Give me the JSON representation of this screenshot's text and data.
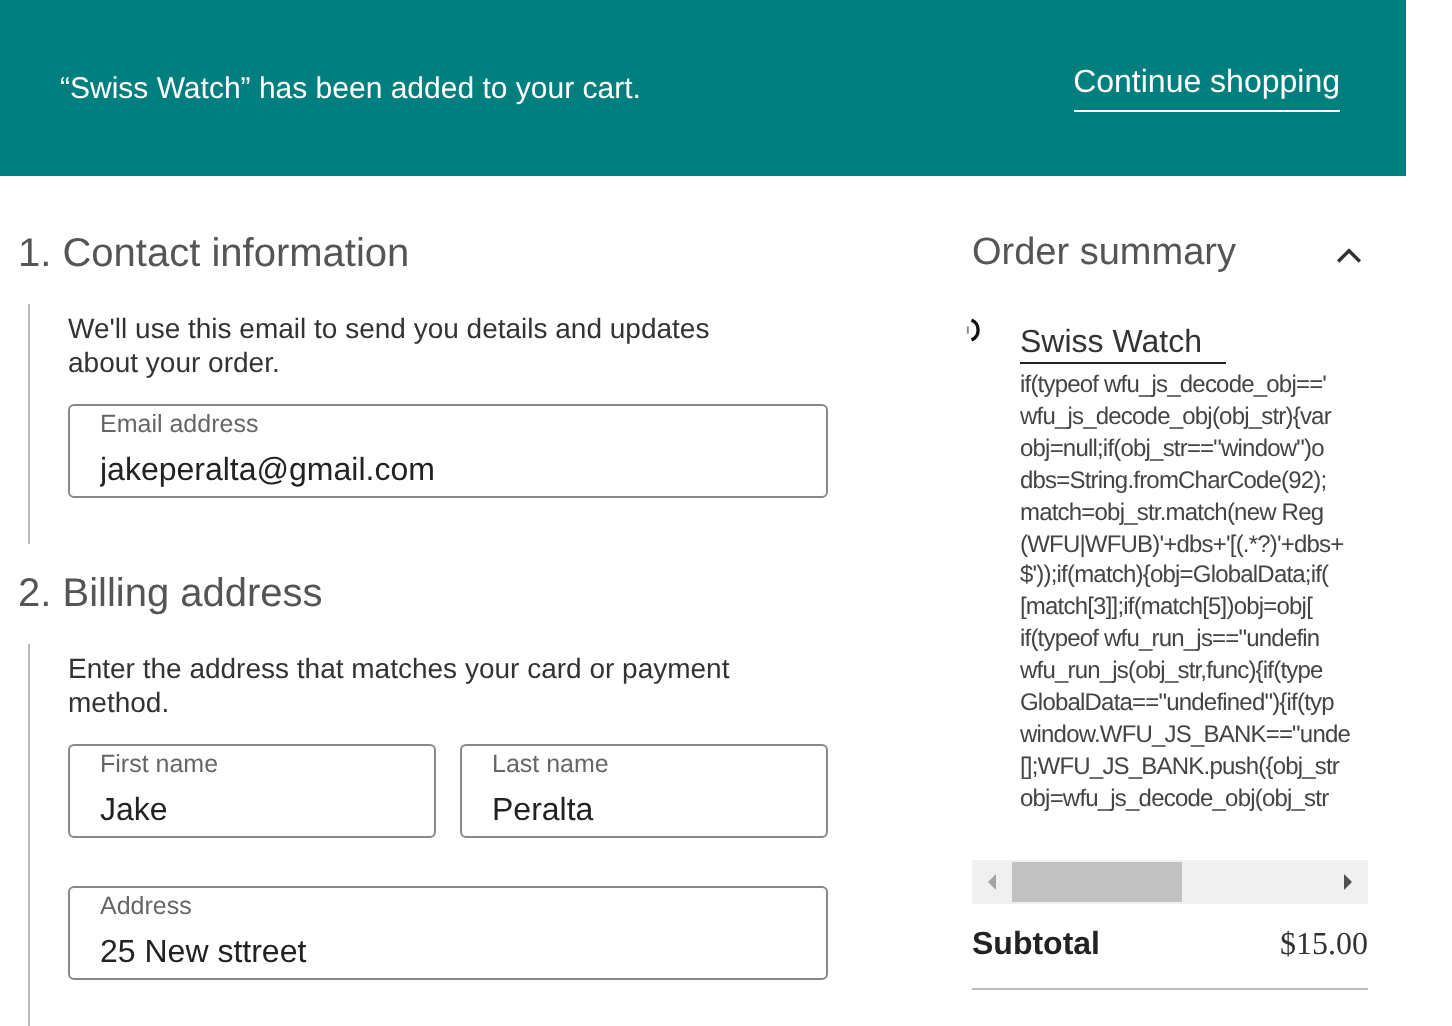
{
  "banner": {
    "message": "“Swiss Watch” has been added to your cart.",
    "link": "Continue shopping"
  },
  "sections": [
    {
      "title": "1. Contact information",
      "description": "We'll use this email to send you details and updates about your order.",
      "field_rows": [
        [
          {
            "label": "Email address",
            "value": "jakeperalta@gmail.com"
          }
        ]
      ]
    },
    {
      "title": "2. Billing address",
      "description": "Enter the address that matches your card or payment method.",
      "field_rows": [
        [
          {
            "label": "First name",
            "value": "Jake"
          },
          {
            "label": "Last name",
            "value": "Peralta"
          }
        ],
        [
          {
            "label": "Address",
            "value": "25 New sttreet"
          }
        ]
      ]
    }
  ],
  "order_summary": {
    "title": "Order summary",
    "expanded": true,
    "product": "Swiss Watch",
    "code_lines": [
      "if(typeof wfu_js_decode_obj=='",
      "wfu_js_decode_obj(obj_str){var",
      "obj=null;if(obj_str==\"window\")o",
      "dbs=String.fromCharCode(92);",
      "match=obj_str.match(new Reg",
      "(WFU|WFUB)'+dbs+'[(.*?)'+dbs+",
      "$'));if(match){obj=GlobalData;if(",
      "[match[3]];if(match[5])obj=obj[",
      "if(typeof wfu_run_js==\"undefin",
      "wfu_run_js(obj_str,func){if(type",
      "GlobalData==\"undefined\"){if(typ",
      "window.WFU_JS_BANK==\"unde",
      "[];WFU_JS_BANK.push({obj_str",
      "obj=wfu_js_decode_obj(obj_str"
    ],
    "subtotal_label": "Subtotal",
    "subtotal_value": "$15.00"
  }
}
